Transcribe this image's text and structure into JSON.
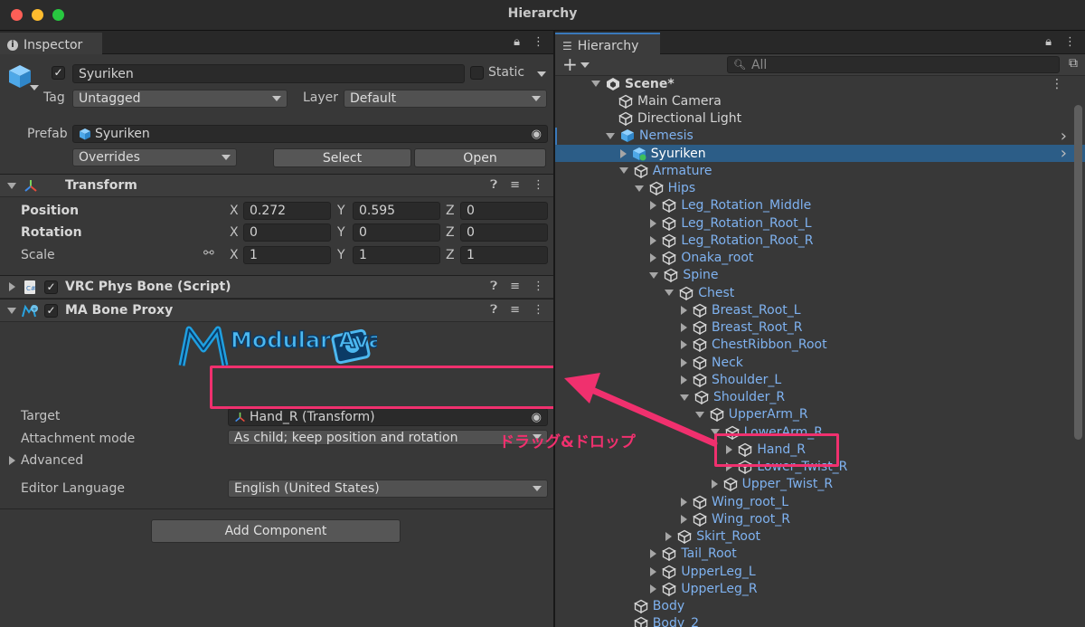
{
  "window": {
    "title": "Hierarchy"
  },
  "inspector": {
    "tab_label": "Inspector",
    "object_name": "Syuriken",
    "static_label": "Static",
    "tag_label": "Tag",
    "tag_value": "Untagged",
    "layer_label": "Layer",
    "layer_value": "Default",
    "prefab_label": "Prefab",
    "prefab_value": "Syuriken",
    "overrides_label": "Overrides",
    "select_label": "Select",
    "open_label": "Open",
    "transform": {
      "title": "Transform",
      "position_label": "Position",
      "rotation_label": "Rotation",
      "scale_label": "Scale",
      "position": {
        "x": "0.272",
        "y": "0.595",
        "z": "0"
      },
      "rotation": {
        "x": "0",
        "y": "0",
        "z": "0"
      },
      "scale": {
        "x": "1",
        "y": "1",
        "z": "1"
      },
      "x": "X",
      "y": "Y",
      "z": "Z"
    },
    "phys_bone_title": "VRC Phys Bone (Script)",
    "bone_proxy_title": "MA Bone Proxy",
    "logo_text": "Modular Avatar",
    "target_label": "Target",
    "target_value": "Hand_R (Transform)",
    "attachment_label": "Attachment mode",
    "attachment_value": "As child; keep position and rotation",
    "advanced_label": "Advanced",
    "editor_language_label": "Editor Language",
    "editor_language_value": "English (United States)",
    "add_component_label": "Add Component"
  },
  "hierarchy": {
    "tab_label": "Hierarchy",
    "add_label": "+",
    "search_placeholder": "All",
    "rows": [
      {
        "name": "Scene*",
        "depth": 0,
        "fold": "down",
        "kind": "scene"
      },
      {
        "name": "Main Camera",
        "depth": 1,
        "fold": "none",
        "kind": "white"
      },
      {
        "name": "Directional Light",
        "depth": 1,
        "fold": "none",
        "kind": "white"
      },
      {
        "name": "Nemesis",
        "depth": 1,
        "fold": "down",
        "kind": "prefab"
      },
      {
        "name": "Syuriken",
        "depth": 2,
        "fold": "right",
        "kind": "selected"
      },
      {
        "name": "Armature",
        "depth": 2,
        "fold": "down",
        "kind": "blue"
      },
      {
        "name": "Hips",
        "depth": 3,
        "fold": "down",
        "kind": "blue"
      },
      {
        "name": "Leg_Rotation_Middle",
        "depth": 4,
        "fold": "right",
        "kind": "blue"
      },
      {
        "name": "Leg_Rotation_Root_L",
        "depth": 4,
        "fold": "right",
        "kind": "blue"
      },
      {
        "name": "Leg_Rotation_Root_R",
        "depth": 4,
        "fold": "right",
        "kind": "blue"
      },
      {
        "name": "Onaka_root",
        "depth": 4,
        "fold": "right",
        "kind": "blue"
      },
      {
        "name": "Spine",
        "depth": 4,
        "fold": "down",
        "kind": "blue"
      },
      {
        "name": "Chest",
        "depth": 5,
        "fold": "down",
        "kind": "blue"
      },
      {
        "name": "Breast_Root_L",
        "depth": 6,
        "fold": "right",
        "kind": "blue"
      },
      {
        "name": "Breast_Root_R",
        "depth": 6,
        "fold": "right",
        "kind": "blue"
      },
      {
        "name": "ChestRibbon_Root",
        "depth": 6,
        "fold": "right",
        "kind": "blue"
      },
      {
        "name": "Neck",
        "depth": 6,
        "fold": "right",
        "kind": "blue"
      },
      {
        "name": "Shoulder_L",
        "depth": 6,
        "fold": "right",
        "kind": "blue"
      },
      {
        "name": "Shoulder_R",
        "depth": 6,
        "fold": "down",
        "kind": "blue"
      },
      {
        "name": "UpperArm_R",
        "depth": 7,
        "fold": "down",
        "kind": "blue"
      },
      {
        "name": "LowerArm_R",
        "depth": 8,
        "fold": "down",
        "kind": "blue"
      },
      {
        "name": "Hand_R",
        "depth": 9,
        "fold": "right",
        "kind": "blue"
      },
      {
        "name": "Lower_Twist_R",
        "depth": 9,
        "fold": "right",
        "kind": "blue"
      },
      {
        "name": "Upper_Twist_R",
        "depth": 8,
        "fold": "right",
        "kind": "blue"
      },
      {
        "name": "Wing_root_L",
        "depth": 6,
        "fold": "right",
        "kind": "blue"
      },
      {
        "name": "Wing_root_R",
        "depth": 6,
        "fold": "right",
        "kind": "blue"
      },
      {
        "name": "Skirt_Root",
        "depth": 5,
        "fold": "right",
        "kind": "blue"
      },
      {
        "name": "Tail_Root",
        "depth": 4,
        "fold": "right",
        "kind": "blue"
      },
      {
        "name": "UpperLeg_L",
        "depth": 4,
        "fold": "right",
        "kind": "blue"
      },
      {
        "name": "UpperLeg_R",
        "depth": 4,
        "fold": "right",
        "kind": "blue"
      },
      {
        "name": "Body",
        "depth": 2,
        "fold": "none",
        "kind": "blue"
      },
      {
        "name": "Body_2",
        "depth": 2,
        "fold": "none",
        "kind": "blue"
      }
    ]
  },
  "annotation": {
    "label": "ドラッグ&ドロップ",
    "color": "#f0306e"
  },
  "colors": {
    "selection": "#2c5d87",
    "link_blue": "#7fb2f0",
    "accent": "#3a79bb"
  }
}
